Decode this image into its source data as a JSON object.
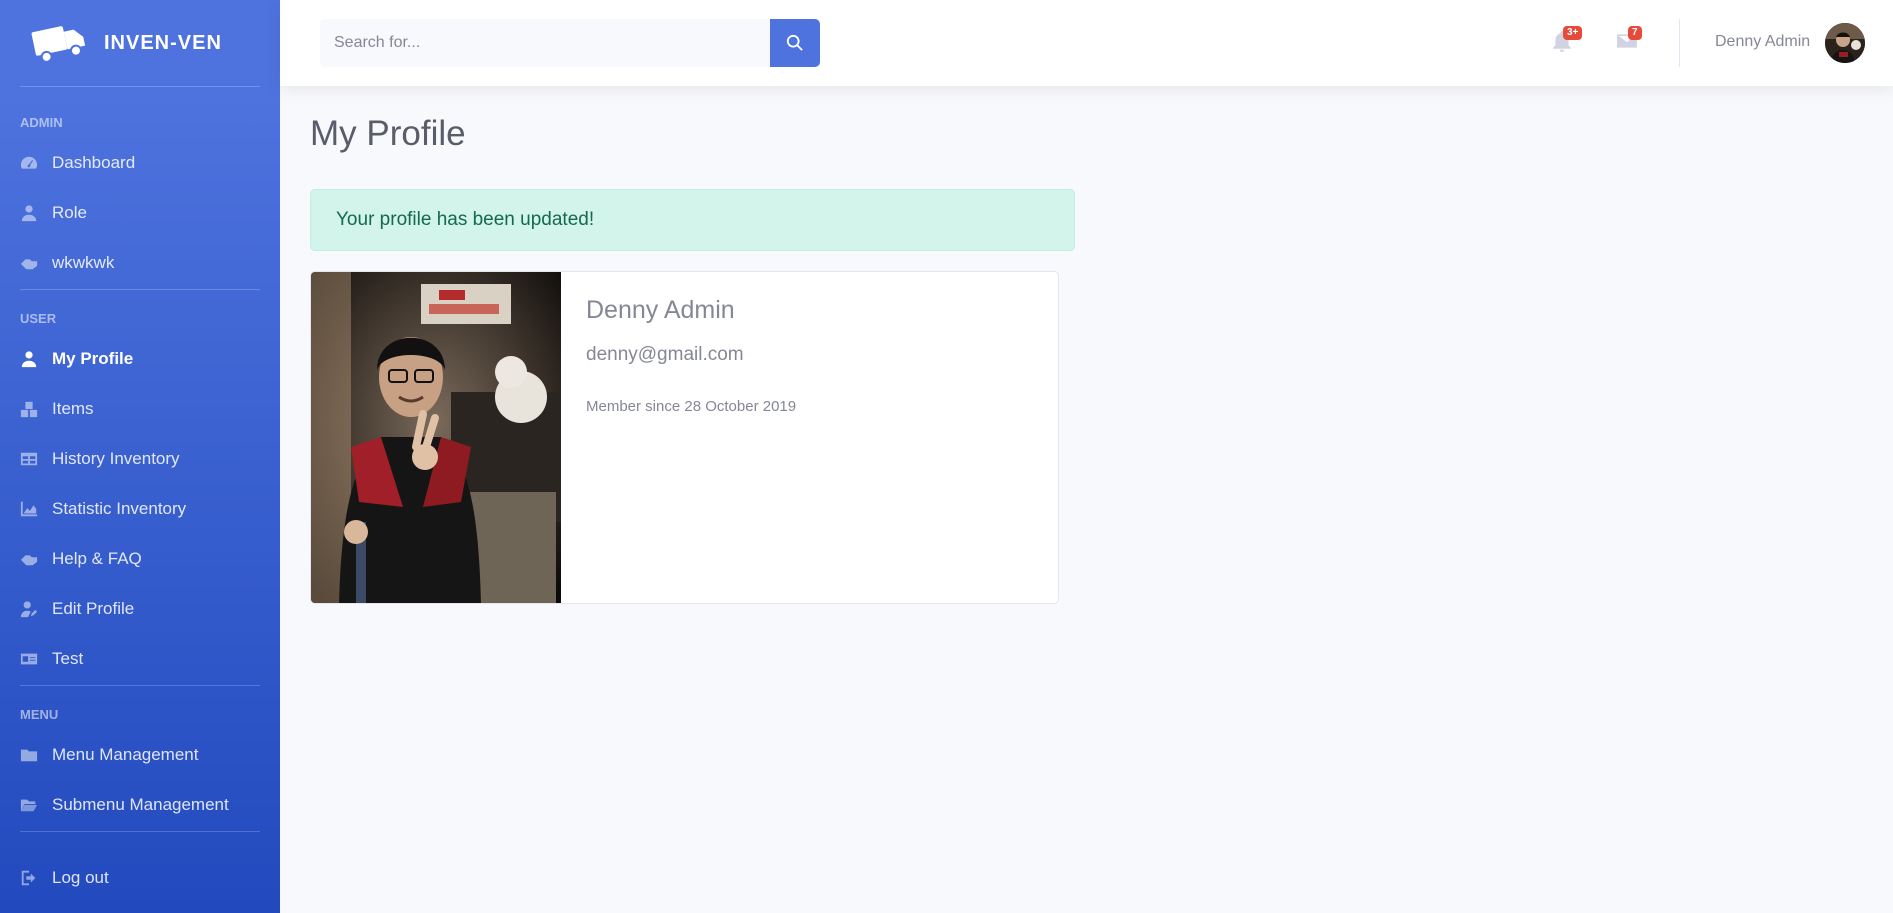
{
  "brand": {
    "name": "INVEN-VEN",
    "logo_icon": "truck-icon"
  },
  "sidebar": {
    "sections": [
      {
        "heading": "ADMIN",
        "items": [
          {
            "label": "Dashboard",
            "icon": "tachometer-icon",
            "active": false
          },
          {
            "label": "Role",
            "icon": "user-tie-icon",
            "active": false
          },
          {
            "label": "wkwkwk",
            "icon": "hands-helping-icon",
            "active": false
          }
        ]
      },
      {
        "heading": "USER",
        "items": [
          {
            "label": "My Profile",
            "icon": "user-icon",
            "active": true
          },
          {
            "label": "Items",
            "icon": "boxes-icon",
            "active": false
          },
          {
            "label": "History Inventory",
            "icon": "table-icon",
            "active": false
          },
          {
            "label": "Statistic Inventory",
            "icon": "chart-area-icon",
            "active": false
          },
          {
            "label": "Help & FAQ",
            "icon": "hands-helping-icon",
            "active": false
          },
          {
            "label": "Edit Profile",
            "icon": "user-edit-icon",
            "active": false
          },
          {
            "label": "Test",
            "icon": "id-card-icon",
            "active": false
          }
        ]
      },
      {
        "heading": "MENU",
        "items": [
          {
            "label": "Menu Management",
            "icon": "folder-icon",
            "active": false
          },
          {
            "label": "Submenu Management",
            "icon": "folder-open-icon",
            "active": false
          }
        ]
      }
    ],
    "logout": {
      "label": "Log out",
      "icon": "sign-out-icon"
    }
  },
  "topbar": {
    "search": {
      "placeholder": "Search for...",
      "button_icon": "search-icon"
    },
    "alerts": {
      "icon": "bell-icon",
      "badge": "3+"
    },
    "messages": {
      "icon": "envelope-icon",
      "badge": "7"
    },
    "user": {
      "name": "Denny Admin",
      "avatar": "avatar-photo"
    }
  },
  "main": {
    "title": "My Profile",
    "alert": "Your profile has been updated!",
    "profile": {
      "name": "Denny Admin",
      "email": "denny@gmail.com",
      "member_since": "Member since 28 October 2019"
    }
  },
  "colors": {
    "primary": "#4e73df",
    "sidebar_gradient_end": "#224abe",
    "success_bg": "#d2f4ea",
    "success_text": "#15694d",
    "badge": "#e74a3b"
  }
}
